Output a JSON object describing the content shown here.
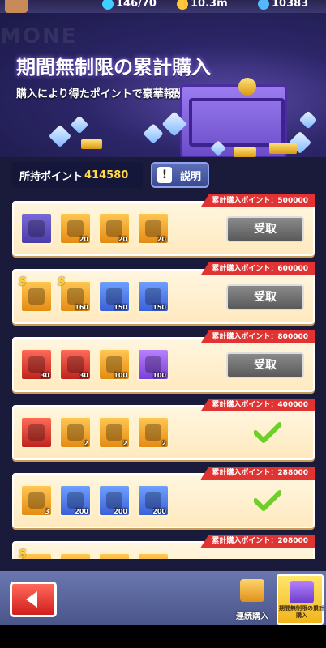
{
  "topbar": {
    "stamina": "146/70",
    "gold": "10.3m",
    "gems": "10383"
  },
  "hero": {
    "ghost_text": "MONE",
    "title": "期間無制限の累計購入",
    "subtitle": "購入により得たポイントで豪華報酬を獲得！"
  },
  "points": {
    "label": "所持ポイント",
    "value": "414580"
  },
  "help_button": {
    "label": "説明"
  },
  "tiers": [
    {
      "tag": "累計購入ポイント：500000",
      "status": "claimable",
      "claim_label": "受取",
      "items": [
        {
          "icon": "hero-portrait-icon",
          "qty": "",
          "color": "face",
          "s": false
        },
        {
          "icon": "treasure-chest-icon",
          "qty": "20",
          "color": "gold",
          "s": false
        },
        {
          "icon": "treasure-chest-icon",
          "qty": "20",
          "color": "gold",
          "s": false
        },
        {
          "icon": "treasure-chest-icon",
          "qty": "20",
          "color": "gold",
          "s": false
        }
      ]
    },
    {
      "tag": "累計購入ポイント：600000",
      "status": "claimable",
      "claim_label": "受取",
      "items": [
        {
          "icon": "armor-box-icon",
          "qty": "",
          "color": "gold",
          "s": true
        },
        {
          "icon": "armor-shard-icon",
          "qty": "160",
          "color": "gold",
          "s": true
        },
        {
          "icon": "blue-emblem-icon",
          "qty": "150",
          "color": "blue",
          "s": false
        },
        {
          "icon": "blue-emblem-icon",
          "qty": "150",
          "color": "blue",
          "s": false
        }
      ]
    },
    {
      "tag": "累計購入ポイント：800000",
      "status": "claimable",
      "claim_label": "受取",
      "items": [
        {
          "icon": "helmet-shard-icon",
          "qty": "30",
          "color": "red",
          "s": false
        },
        {
          "icon": "sword-shard-icon",
          "qty": "30",
          "color": "red",
          "s": false
        },
        {
          "icon": "gold-medal-icon",
          "qty": "100",
          "color": "gold",
          "s": false
        },
        {
          "icon": "purple-medal-icon",
          "qty": "100",
          "color": "purple",
          "s": false
        }
      ]
    },
    {
      "tag": "累計購入ポイント：400000",
      "status": "claimed",
      "claim_label": "",
      "items": [
        {
          "icon": "sword-icon",
          "qty": "",
          "color": "red",
          "s": false
        },
        {
          "icon": "equipment-box-icon",
          "qty": "2",
          "color": "gold",
          "s": false
        },
        {
          "icon": "equipment-box-icon",
          "qty": "2",
          "color": "gold",
          "s": false
        },
        {
          "icon": "equipment-box-icon",
          "qty": "2",
          "color": "gold",
          "s": false
        }
      ]
    },
    {
      "tag": "累計購入ポイント：288000",
      "status": "claimed",
      "claim_label": "",
      "items": [
        {
          "icon": "gold-box-icon",
          "qty": "3",
          "color": "gold",
          "s": false
        },
        {
          "icon": "blue-crystal-box-icon",
          "qty": "200",
          "color": "blue",
          "s": false
        },
        {
          "icon": "blue-crystal-box-icon",
          "qty": "200",
          "color": "blue",
          "s": false
        },
        {
          "icon": "blue-crystal-box-icon",
          "qty": "200",
          "color": "blue",
          "s": false
        }
      ]
    },
    {
      "tag": "累計購入ポイント：208000",
      "status": "partial",
      "claim_label": "",
      "items": [
        {
          "icon": "item-icon",
          "qty": "",
          "color": "gold",
          "s": true
        },
        {
          "icon": "item-icon",
          "qty": "",
          "color": "gold",
          "s": false
        },
        {
          "icon": "item-icon",
          "qty": "",
          "color": "gold",
          "s": false
        },
        {
          "icon": "item-icon",
          "qty": "",
          "color": "gold",
          "s": false
        }
      ]
    }
  ],
  "bottom_nav": {
    "tabs": [
      {
        "label": "連続購入",
        "active": false
      },
      {
        "label": "期間無制限の累計購入",
        "active": true
      }
    ]
  },
  "colors": {
    "tag_red": "#e23333",
    "accent_gold": "#ffd84a",
    "check_green": "#6fcf2a"
  }
}
